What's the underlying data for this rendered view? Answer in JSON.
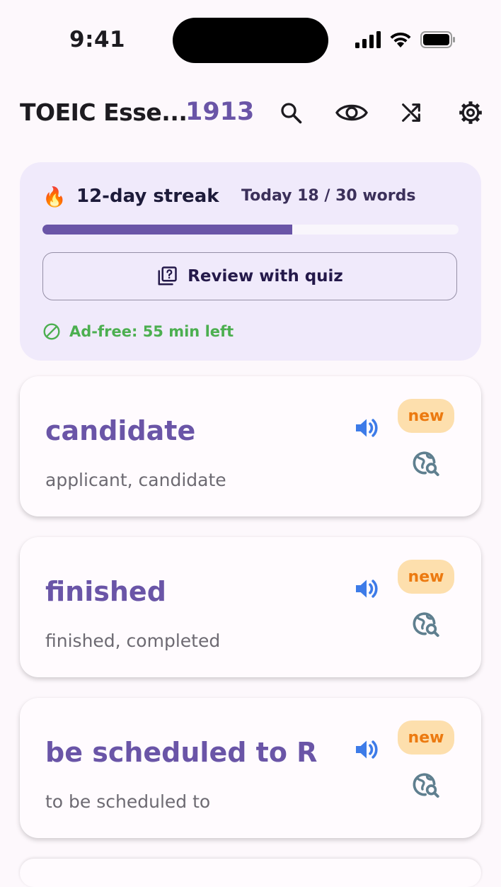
{
  "status_bar": {
    "time": "9:41"
  },
  "app_bar": {
    "title": "TOEIC Esse...",
    "word_count": "1913"
  },
  "streak_card": {
    "streak_label": "12-day streak",
    "today_label": "Today 18 / 30 words",
    "progress_fraction": 0.6,
    "quiz_button_label": "Review with quiz",
    "adfree_label": "Ad-free: 55 min left"
  },
  "words": [
    {
      "word": "candidate",
      "meaning": "applicant, candidate",
      "badge": "new"
    },
    {
      "word": "finished",
      "meaning": "finished, completed",
      "badge": "new"
    },
    {
      "word": "be scheduled to R",
      "meaning": "to be scheduled to",
      "badge": "new"
    }
  ],
  "colors": {
    "accent": "#6a55a7",
    "streak_bg": "#f0eafb",
    "badge_bg": "#fddfad",
    "badge_text": "#ec7a10",
    "adfree": "#4caf50",
    "speaker": "#3d7be8"
  },
  "icons": {
    "search": "search-icon",
    "eye": "eye-icon",
    "shuffle": "shuffle-icon",
    "settings": "gear-icon",
    "fire": "fire-icon",
    "quiz": "quiz-icon",
    "adfree": "block-icon",
    "speaker": "speaker-icon",
    "lookup": "travel-explore-icon"
  }
}
